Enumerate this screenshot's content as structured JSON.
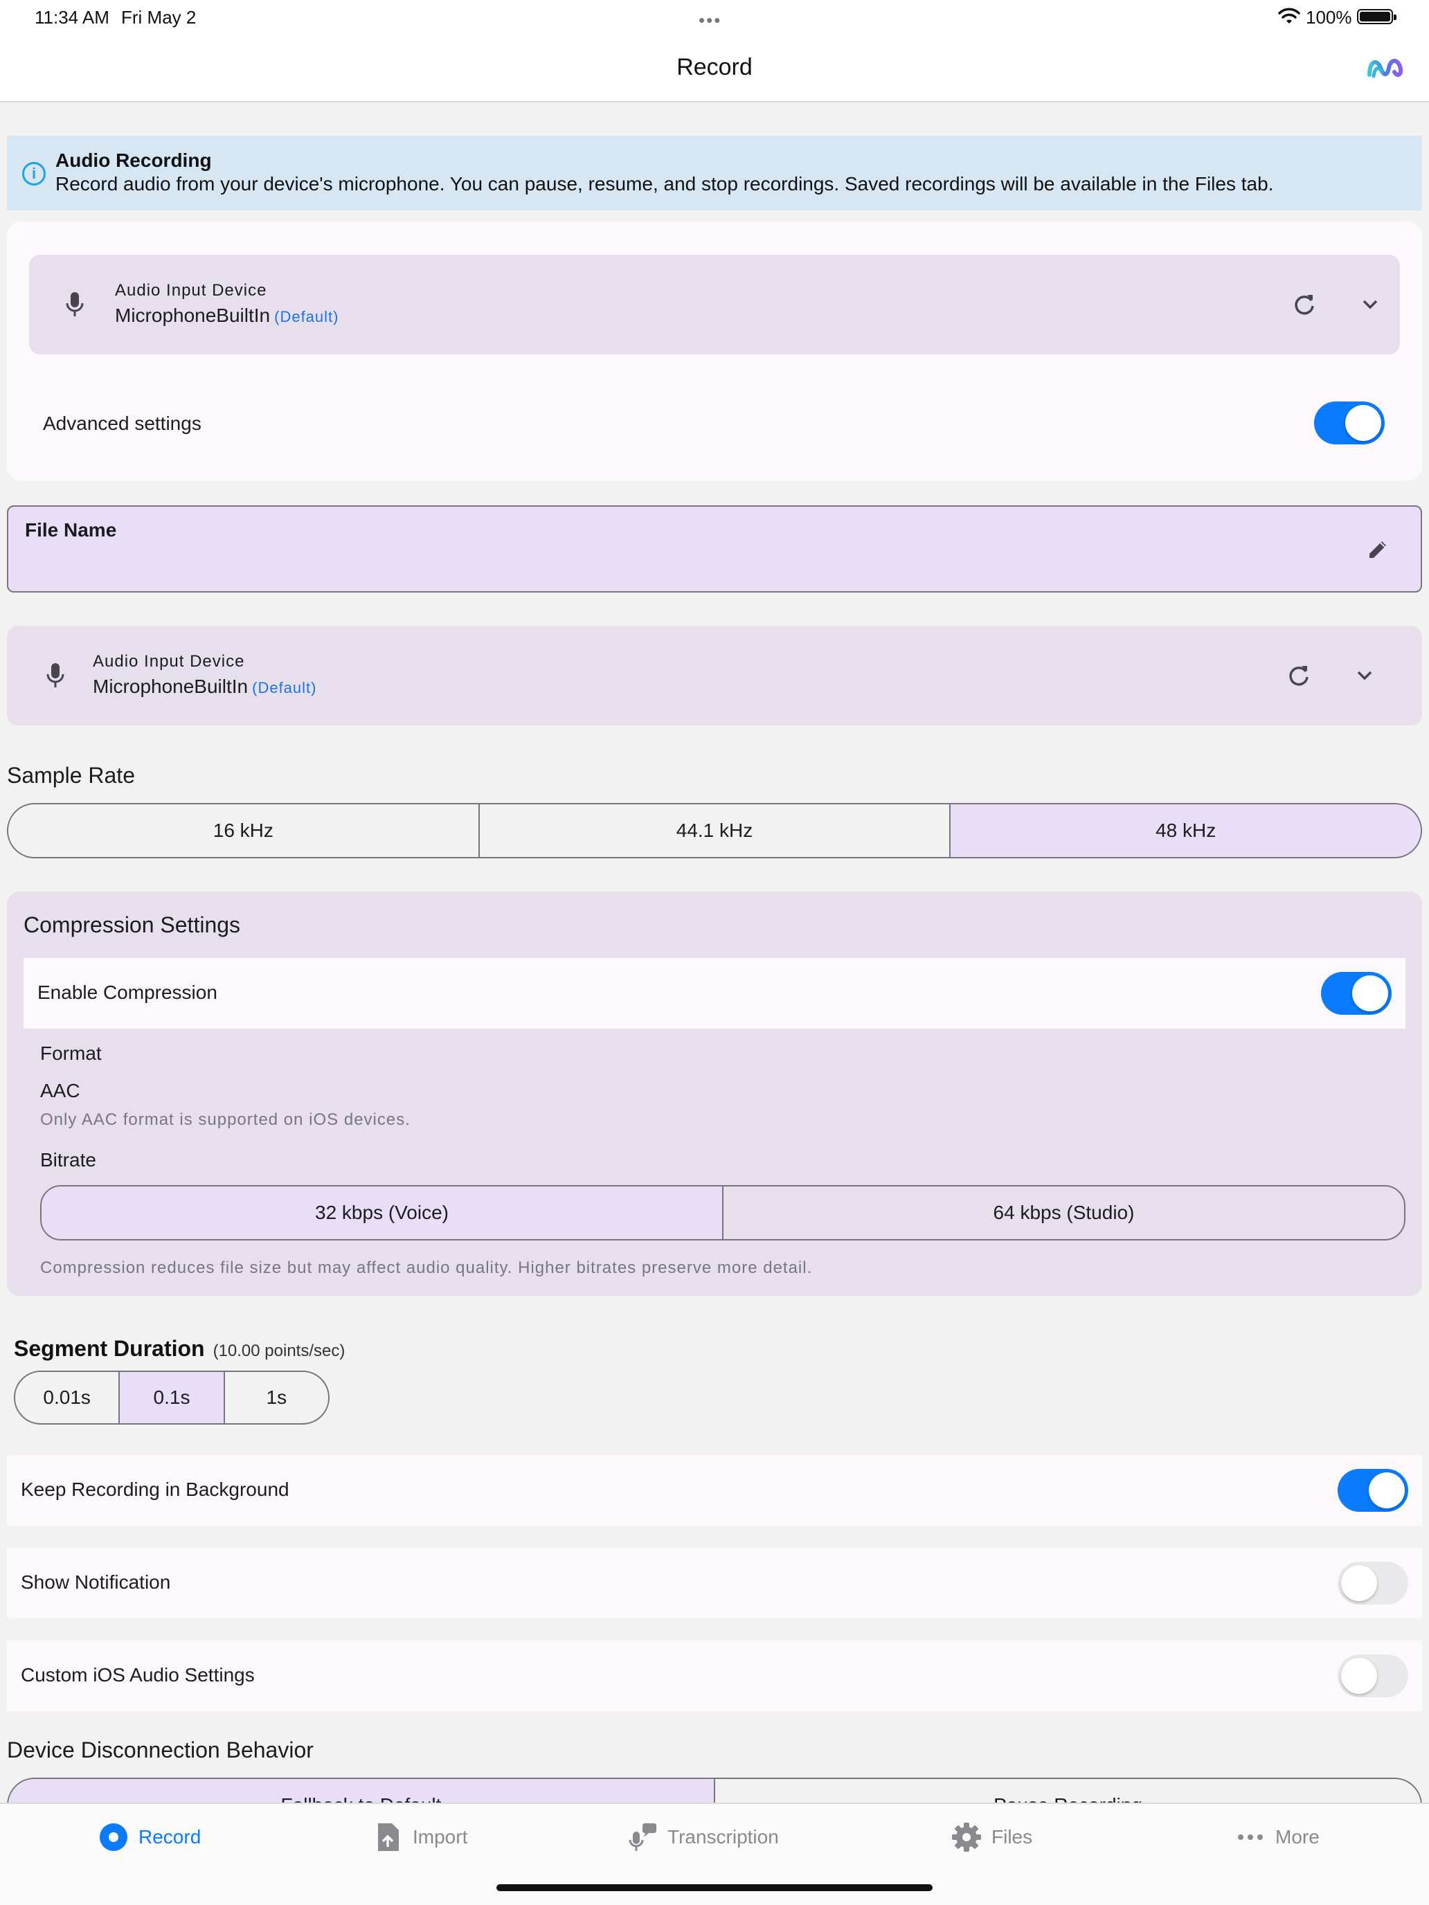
{
  "status_bar": {
    "time": "11:34 AM",
    "date": "Fri May 2",
    "battery": "100%"
  },
  "nav": {
    "title": "Record"
  },
  "info_banner": {
    "title": "Audio Recording",
    "text": "Record audio from your device's microphone. You can pause, resume, and stop recordings. Saved recordings will be available in the Files tab."
  },
  "card": {
    "device": {
      "label": "Audio Input Device",
      "name": "MicrophoneBuiltIn",
      "default_tag": "(Default)"
    },
    "advanced_settings": {
      "label": "Advanced settings",
      "enabled": true
    }
  },
  "file_name": {
    "label": "File Name"
  },
  "device2": {
    "label": "Audio Input Device",
    "name": "MicrophoneBuiltIn",
    "default_tag": "(Default)"
  },
  "sample_rate": {
    "title": "Sample Rate",
    "options": [
      "16 kHz",
      "44.1 kHz",
      "48 kHz"
    ],
    "selected": "48 kHz"
  },
  "compression": {
    "title": "Compression Settings",
    "enable_label": "Enable Compression",
    "enabled": true,
    "format_label": "Format",
    "format_value": "AAC",
    "format_hint": "Only AAC format is supported on iOS devices.",
    "bitrate_label": "Bitrate",
    "bitrate_options": [
      "32 kbps (Voice)",
      "64 kbps (Studio)"
    ],
    "bitrate_selected": "32 kbps (Voice)",
    "note": "Compression reduces file size but may affect audio quality. Higher bitrates preserve more detail."
  },
  "segment_duration": {
    "title": "Segment Duration",
    "subtitle": "(10.00 points/sec)",
    "options": [
      "0.01s",
      "0.1s",
      "1s"
    ],
    "selected": "0.1s"
  },
  "switches": {
    "background": {
      "label": "Keep Recording in Background",
      "enabled": true
    },
    "notification": {
      "label": "Show Notification",
      "enabled": false
    },
    "ios_audio": {
      "label": "Custom iOS Audio Settings",
      "enabled": false
    }
  },
  "disconnection": {
    "title": "Device Disconnection Behavior",
    "options": [
      "Fallback to Default",
      "Pause Recording"
    ],
    "selected": "Fallback to Default"
  },
  "tabs": [
    {
      "label": "Record",
      "icon": "record-icon",
      "active": true
    },
    {
      "label": "Import",
      "icon": "import-icon",
      "active": false
    },
    {
      "label": "Transcription",
      "icon": "transcription-icon",
      "active": false
    },
    {
      "label": "Files",
      "icon": "gear-icon",
      "active": false
    },
    {
      "label": "More",
      "icon": "more-icon",
      "active": false
    }
  ],
  "colors": {
    "accent": "#0a7aff",
    "selected_segment": "#e8def8",
    "device_box": "#e7e0ec",
    "info_icon": "#1ba4e6",
    "default_tag": "#1a73e8"
  }
}
